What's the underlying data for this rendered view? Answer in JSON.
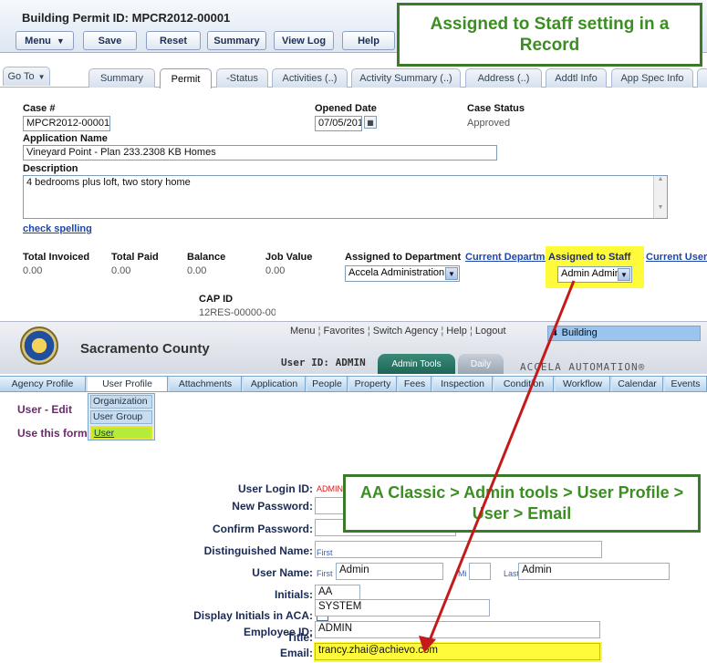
{
  "record": {
    "title": "Building Permit ID: MPCR2012-00001",
    "toolbar": {
      "menu": "Menu",
      "save": "Save",
      "reset": "Reset",
      "summary": "Summary",
      "view_log": "View Log",
      "help": "Help"
    },
    "tabs": [
      "Go To",
      "Summary",
      "Permit",
      "-Status",
      "Activities (..)",
      "Activity Summary (..)",
      "Address (..)",
      "Addtl Info",
      "App Spec Info"
    ],
    "active_tab": "Permit",
    "fields": {
      "case_label": "Case #",
      "case_value": "MPCR2012-00001",
      "opened_label": "Opened Date",
      "opened_value": "07/05/201",
      "status_label": "Case Status",
      "status_value": "Approved",
      "app_name_label": "Application Name",
      "app_name_value": "Vineyard Point - Plan 233.2308   KB Homes",
      "desc_label": "Description",
      "desc_value": "4 bedrooms plus loft, two story home",
      "check_spelling": "check spelling",
      "total_invoiced_label": "Total Invoiced",
      "total_invoiced_value": "0.00",
      "total_paid_label": "Total Paid",
      "total_paid_value": "0.00",
      "balance_label": "Balance",
      "balance_value": "0.00",
      "job_value_label": "Job Value",
      "job_value_value": "0.00",
      "assigned_dept_label": "Assigned to Department",
      "assigned_dept_value": "Accela Administration",
      "current_department": "Current Department",
      "assigned_staff_label": "Assigned to Staff",
      "assigned_staff_value": "Admin Admin",
      "current_user": "Current User",
      "cap_id_label": "CAP ID",
      "cap_id_value": "12RES-00000-00"
    }
  },
  "callouts": {
    "top": "Assigned to Staff setting in a Record",
    "bottom": "AA Classic > Admin tools > User Profile > User > Email"
  },
  "classic": {
    "county": "Sacramento County",
    "links": [
      "Menu",
      "Favorites",
      "Switch Agency",
      "Help",
      "Logout"
    ],
    "building": "Building",
    "user_id": "User ID: ADMIN",
    "tab_admin": "Admin Tools",
    "tab_daily": "Daily",
    "brand": "ACCELA AUTOMATION®",
    "modules": [
      "Agency Profile",
      "User Profile",
      "Attachments",
      "Application",
      "People",
      "Property",
      "Fees",
      "Inspection",
      "Condition",
      "Workflow",
      "Calendar",
      "Events"
    ],
    "active_module": "User Profile",
    "dropdown": [
      "Organization",
      "User Group",
      "User"
    ],
    "heading": "User - Edit",
    "use_form": "Use this form",
    "form": {
      "login_label": "User Login ID:",
      "login_value": "ADMIN",
      "new_pw_label": "New Password:",
      "confirm_pw_label": "Confirm Password:",
      "dn_label": "Distinguished Name:",
      "name_label": "User Name:",
      "first_tag": "First",
      "first_value": "Admin",
      "mi_tag": "Mi",
      "last_tag": "Last",
      "last_value": "Admin",
      "initials_label": "Initials:",
      "initials_value": "AA",
      "display_initials_label": "Display Initials in ACA:",
      "title_label": "Title:",
      "title_value": "SYSTEM",
      "employee_label": "Employee ID:",
      "employee_value": "ADMIN",
      "email_label": "Email:",
      "email_value": "trancy.zhai@achievo.com"
    }
  },
  "colors": {
    "highlight": "#fffa3a",
    "callout_green": "#3b8e22",
    "arrow_red": "#c41a1a",
    "link_blue": "#1f47a8"
  }
}
